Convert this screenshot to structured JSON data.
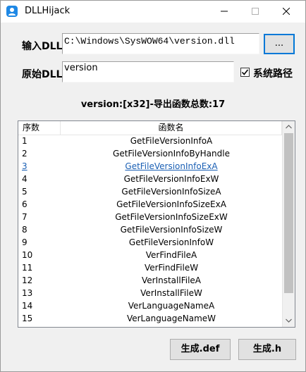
{
  "window": {
    "title": "DLLHijack",
    "controls": {
      "minimize": "minimize-icon",
      "maximize": "maximize-icon",
      "close": "close-icon"
    }
  },
  "form": {
    "input_dll_label": "输入DLL",
    "input_dll_value": "C:\\Windows\\SysWOW64\\version.dll",
    "browse_label": "...",
    "original_dll_label": "原始DLL",
    "original_dll_value": "version",
    "system_path_label": "系统路径",
    "system_path_checked": true
  },
  "summary": {
    "text": "version:[x32]-导出函数总数:17"
  },
  "list": {
    "columns": [
      "序数",
      "函数名"
    ],
    "rows": [
      {
        "idx": "1",
        "name": "GetFileVersionInfoA"
      },
      {
        "idx": "2",
        "name": "GetFileVersionInfoByHandle"
      },
      {
        "idx": "3",
        "name": "GetFileVersionInfoExA"
      },
      {
        "idx": "4",
        "name": "GetFileVersionInfoExW"
      },
      {
        "idx": "5",
        "name": "GetFileVersionInfoSizeA"
      },
      {
        "idx": "6",
        "name": "GetFileVersionInfoSizeExA"
      },
      {
        "idx": "7",
        "name": "GetFileVersionInfoSizeExW"
      },
      {
        "idx": "8",
        "name": "GetFileVersionInfoSizeW"
      },
      {
        "idx": "9",
        "name": "GetFileVersionInfoW"
      },
      {
        "idx": "10",
        "name": "VerFindFileA"
      },
      {
        "idx": "11",
        "name": "VerFindFileW"
      },
      {
        "idx": "12",
        "name": "VerInstallFileA"
      },
      {
        "idx": "13",
        "name": "VerInstallFileW"
      },
      {
        "idx": "14",
        "name": "VerLanguageNameA"
      },
      {
        "idx": "15",
        "name": "VerLanguageNameW"
      }
    ],
    "highlighted_row": 3
  },
  "actions": {
    "gen_def": "生成.def",
    "gen_h": "生成.h"
  },
  "colors": {
    "link": "#1a5fb4",
    "accent": "#0078d7",
    "window_bg": "#f0f0f0"
  }
}
